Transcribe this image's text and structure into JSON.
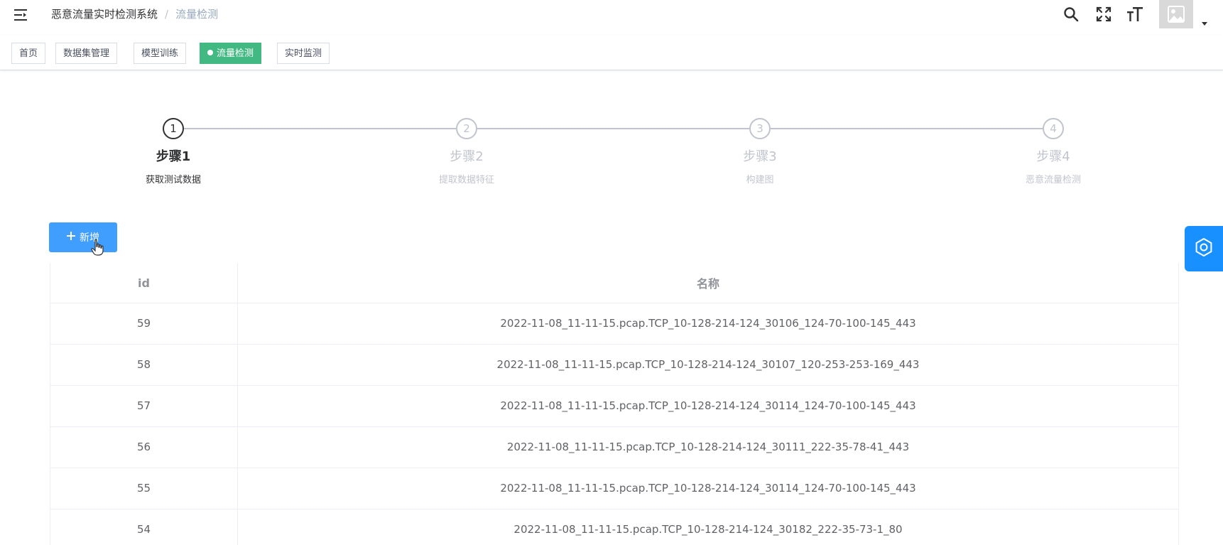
{
  "navbar": {
    "breadcrumb": [
      "恶意流量实时检测系统",
      "流量检测"
    ],
    "separator": "/",
    "icons": [
      "hamburger-icon",
      "search-icon",
      "fullscreen-icon",
      "font-size-icon",
      "avatar",
      "caret-down-icon"
    ]
  },
  "tags": [
    {
      "label": "首页",
      "active": false
    },
    {
      "label": "数据集管理",
      "active": false
    },
    {
      "label": "模型训练",
      "active": false
    },
    {
      "label": "流量检测",
      "active": true
    },
    {
      "label": "实时监测",
      "active": false
    }
  ],
  "steps": [
    {
      "number": "1",
      "title": "步骤1",
      "description": "获取测试数据",
      "active": true
    },
    {
      "number": "2",
      "title": "步骤2",
      "description": "提取数据特征",
      "active": false
    },
    {
      "number": "3",
      "title": "步骤3",
      "description": "构建图",
      "active": false
    },
    {
      "number": "4",
      "title": "步骤4",
      "description": "恶意流量检测",
      "active": false
    }
  ],
  "add_button": {
    "label": "新增",
    "icon": "plus-icon"
  },
  "table": {
    "columns": [
      "id",
      "名称"
    ],
    "rows": [
      {
        "id": "59",
        "name": "2022-11-08_11-11-15.pcap.TCP_10-128-214-124_30106_124-70-100-145_443"
      },
      {
        "id": "58",
        "name": "2022-11-08_11-11-15.pcap.TCP_10-128-214-124_30107_120-253-253-169_443"
      },
      {
        "id": "57",
        "name": "2022-11-08_11-11-15.pcap.TCP_10-128-214-124_30114_124-70-100-145_443"
      },
      {
        "id": "56",
        "name": "2022-11-08_11-11-15.pcap.TCP_10-128-214-124_30111_222-35-78-41_443"
      },
      {
        "id": "55",
        "name": "2022-11-08_11-11-15.pcap.TCP_10-128-214-124_30114_124-70-100-145_443"
      },
      {
        "id": "54",
        "name": "2022-11-08_11-11-15.pcap.TCP_10-128-214-124_30182_222-35-73-1_80"
      }
    ]
  },
  "settings_button": {
    "icon": "settings-icon"
  },
  "colors": {
    "primary": "#409eff",
    "active_tag": "#42b983",
    "settings": "#1890ff"
  }
}
